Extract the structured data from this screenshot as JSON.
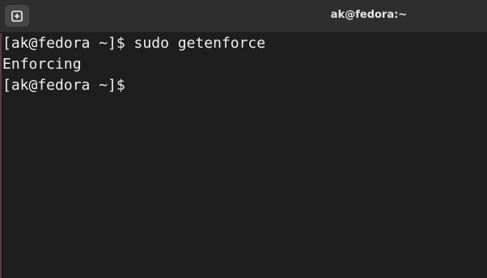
{
  "window": {
    "title": "ak@fedora:~"
  },
  "toolbar": {
    "new_tab_icon": "new-tab-icon"
  },
  "terminal": {
    "lines": [
      "[ak@fedora ~]$ sudo getenforce",
      "Enforcing",
      "[ak@fedora ~]$ "
    ]
  },
  "colors": {
    "background": "#1e1e1e",
    "titlebar": "#2e2e2e",
    "text": "#f0f0f0"
  }
}
